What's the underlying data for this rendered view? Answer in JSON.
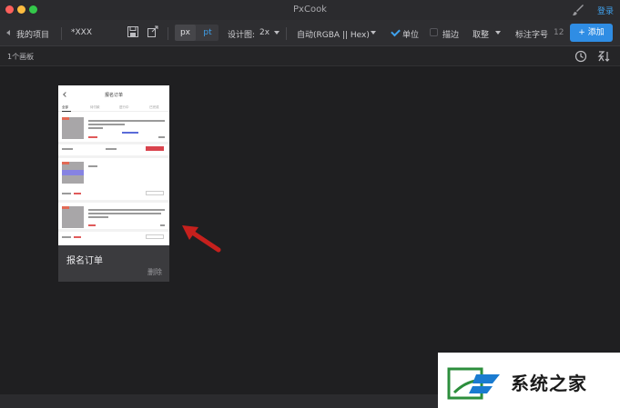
{
  "window": {
    "title": "PxCook",
    "login_label": "登录"
  },
  "toolbar": {
    "project_label": "我的项目",
    "file_name": "*XXX",
    "unit_px": "px",
    "unit_pt": "pt",
    "design_scale_label": "设计图:",
    "design_scale_value": "2x",
    "color_format_value": "自动(RGBA || Hex)",
    "unit_checkbox_label": "单位",
    "unit_checked": true,
    "stroke_checkbox_label": "描边",
    "stroke_checked": false,
    "rounding_value": "取整",
    "font_size_label": "标注字号",
    "font_size_value": "12",
    "add_button_label": "添加"
  },
  "panel_bar": {
    "count_label": "1个画板"
  },
  "artboard": {
    "title": "报名订单",
    "action_label": "删除",
    "phone": {
      "nav_title": "报名订单",
      "tabs": [
        "全部",
        "待付款",
        "进行中",
        "已完成"
      ]
    }
  },
  "watermark": {
    "text": "系统之家"
  },
  "colors": {
    "accent": "#2f8de4",
    "link": "#3fa2ee",
    "background": "#1f1f21",
    "arrow": "#c6201d"
  }
}
